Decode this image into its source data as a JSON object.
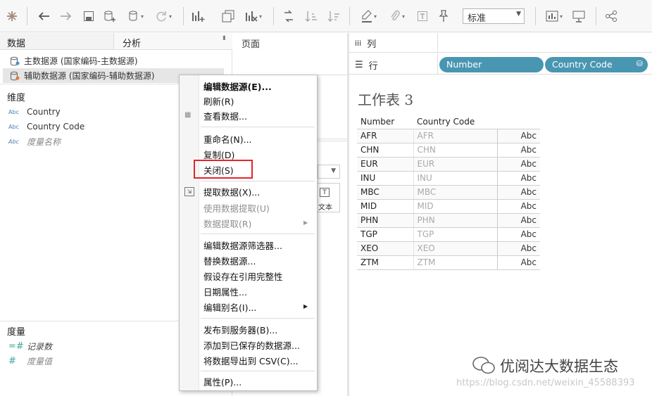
{
  "toolbar": {
    "view_select": "标准"
  },
  "left": {
    "tab_data": "数据",
    "tab_analysis": "分析",
    "datasources": [
      {
        "label": "主数据源 (国家编码-主数据源)"
      },
      {
        "label": "辅助数据源 (国家编码-辅助数据源)"
      }
    ],
    "dimensions_title": "维度",
    "dimensions": [
      {
        "type": "Abc",
        "label": "Country"
      },
      {
        "type": "Abc",
        "label": "Country Code"
      },
      {
        "type": "Abc",
        "label": "度量名称"
      }
    ],
    "measures_title": "度量",
    "measures": [
      {
        "type": "=#",
        "label": "记录数"
      },
      {
        "type": "#",
        "label": "度量值"
      }
    ]
  },
  "mid": {
    "pages_label": "页面",
    "marks_text_label": "文本"
  },
  "shelves": {
    "columns_label": "列",
    "rows_label": "行",
    "row_pills": [
      "Number",
      "Country Code"
    ]
  },
  "sheet": {
    "title": "工作表 3",
    "headers": [
      "Number",
      "Country Code"
    ],
    "rows": [
      [
        "AFR",
        "AFR",
        "Abc"
      ],
      [
        "CHN",
        "CHN",
        "Abc"
      ],
      [
        "EUR",
        "EUR",
        "Abc"
      ],
      [
        "INU",
        "INU",
        "Abc"
      ],
      [
        "MBC",
        "MBC",
        "Abc"
      ],
      [
        "MID",
        "MID",
        "Abc"
      ],
      [
        "PHN",
        "PHN",
        "Abc"
      ],
      [
        "TGP",
        "TGP",
        "Abc"
      ],
      [
        "XEO",
        "XEO",
        "Abc"
      ],
      [
        "ZTM",
        "ZTM",
        "Abc"
      ]
    ]
  },
  "menu": {
    "edit_datasource": "编辑数据源(E)...",
    "refresh": "刷新(R)",
    "view_data": "查看数据...",
    "rename": "重命名(N)...",
    "duplicate": "复制(D)",
    "close": "关闭(S)",
    "extract_data": "提取数据(X)...",
    "use_extract": "使用数据提取(U)",
    "data_extract": "数据提取(R)",
    "edit_filters": "编辑数据源筛选器...",
    "replace_ds": "替换数据源...",
    "assume_ri": "假设存在引用完整性",
    "date_props": "日期属性...",
    "edit_aliases": "编辑别名(I)...",
    "publish": "发布到服务器(B)...",
    "add_saved": "添加到已保存的数据源...",
    "export_csv": "将数据导出到 CSV(C)...",
    "properties": "属性(P)..."
  },
  "watermark": {
    "text": "优阅达大数据生态",
    "url": "https://blog.csdn.net/weixin_45588393"
  },
  "colors": {
    "pill": "#4996b2",
    "highlight": "#e0262b"
  }
}
